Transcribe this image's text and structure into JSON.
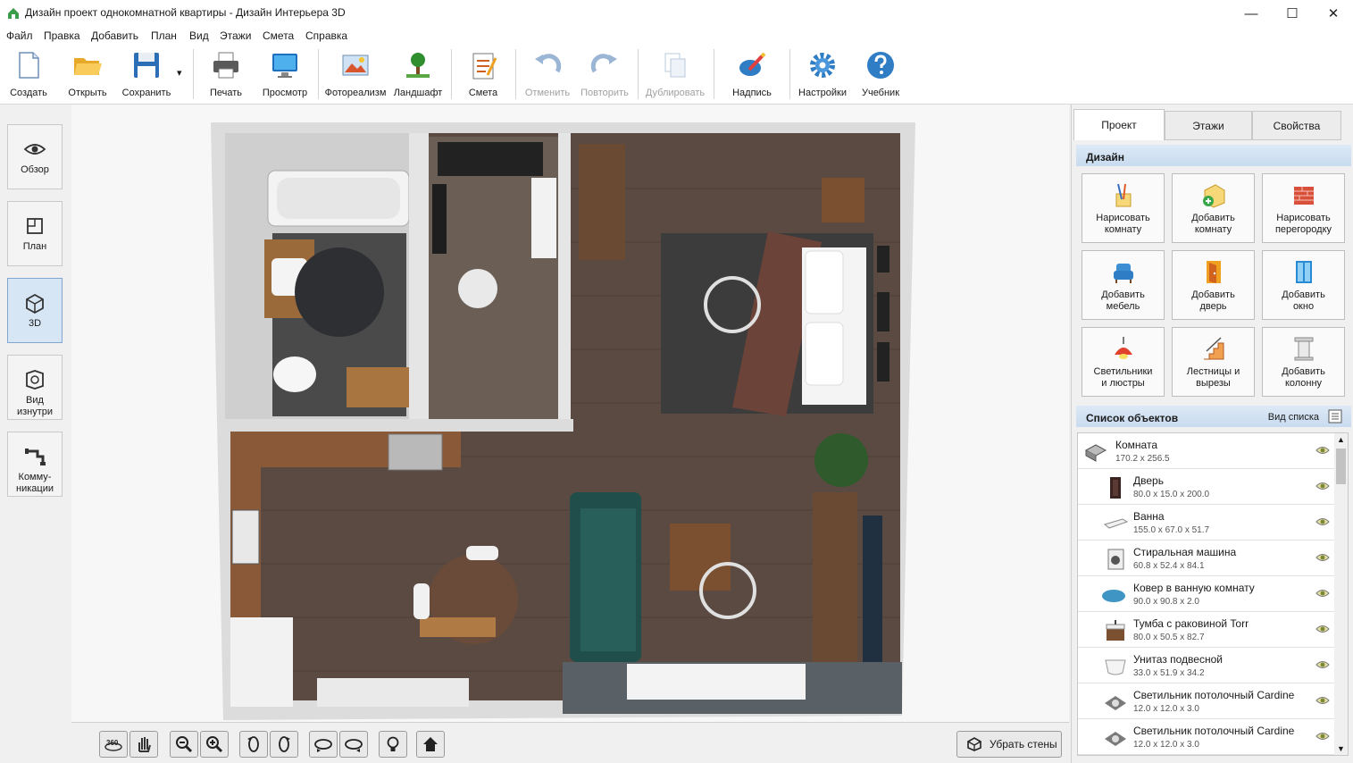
{
  "window": {
    "title": "Дизайн проект однокомнатной квартиры - Дизайн Интерьера 3D",
    "controls": {
      "minimize": "—",
      "maximize": "☐",
      "close": "✕"
    }
  },
  "menu": [
    "Файл",
    "Правка",
    "Добавить",
    "План",
    "Вид",
    "Этажи",
    "Смета",
    "Справка"
  ],
  "toolbar": {
    "create": "Создать",
    "open": "Открыть",
    "save": "Сохранить",
    "save_dropdown": "▾",
    "print": "Печать",
    "preview": "Просмотр",
    "photorealism": "Фотореализм",
    "landscape": "Ландшафт",
    "estimate": "Смета",
    "undo": "Отменить",
    "redo": "Повторить",
    "duplicate": "Дублировать",
    "caption": "Надпись",
    "settings": "Настройки",
    "tutorial": "Учебник"
  },
  "left_nav": [
    {
      "label": "Обзор",
      "icon": "eye-icon",
      "active": false
    },
    {
      "label": "План",
      "icon": "plan-icon",
      "active": false
    },
    {
      "label": "3D",
      "icon": "cube-house-icon",
      "active": true
    },
    {
      "label": "Вид изнутри",
      "icon": "inside-view-icon",
      "active": false
    },
    {
      "label": "Комму-никации",
      "icon": "pipes-icon",
      "active": false
    }
  ],
  "view_controls": {
    "remove_walls": "Убрать стены",
    "rotate_360": "360"
  },
  "right_panel": {
    "tabs": [
      "Проект",
      "Этажи",
      "Свойства"
    ],
    "active_tab": "Проект",
    "design_header": "Дизайн",
    "design_tiles": [
      "Нарисовать комнату",
      "Добавить комнату",
      "Нарисовать перегородку",
      "Добавить мебель",
      "Добавить дверь",
      "Добавить окно",
      "Светильники и люстры",
      "Лестницы и вырезы",
      "Добавить колонну"
    ],
    "objects_header": "Список объектов",
    "list_view": "Вид списка",
    "objects": [
      {
        "name": "Комната",
        "dims": "170.2 x 256.5"
      },
      {
        "name": "Дверь",
        "dims": "80.0 x 15.0 x 200.0"
      },
      {
        "name": "Ванна",
        "dims": "155.0 x 67.0 x 51.7"
      },
      {
        "name": "Стиральная машина",
        "dims": "60.8 x 52.4 x 84.1"
      },
      {
        "name": "Ковер в ванную комнату",
        "dims": "90.0 x 90.8 x 2.0"
      },
      {
        "name": "Тумба с раковиной Torr",
        "dims": "80.0 x 50.5 x 82.7"
      },
      {
        "name": "Унитаз подвесной",
        "dims": "33.0 x 51.9 x 34.2"
      },
      {
        "name": "Светильник потолочный Cardine",
        "dims": "12.0 x 12.0 x 3.0"
      },
      {
        "name": "Светильник потолочный Cardine",
        "dims": "12.0 x 12.0 x 3.0"
      }
    ]
  },
  "colors": {
    "accent": "#2b6cb0",
    "active_nav": "#d7e6f5",
    "section": "#c8dbef",
    "floor": "#5a4a42"
  }
}
